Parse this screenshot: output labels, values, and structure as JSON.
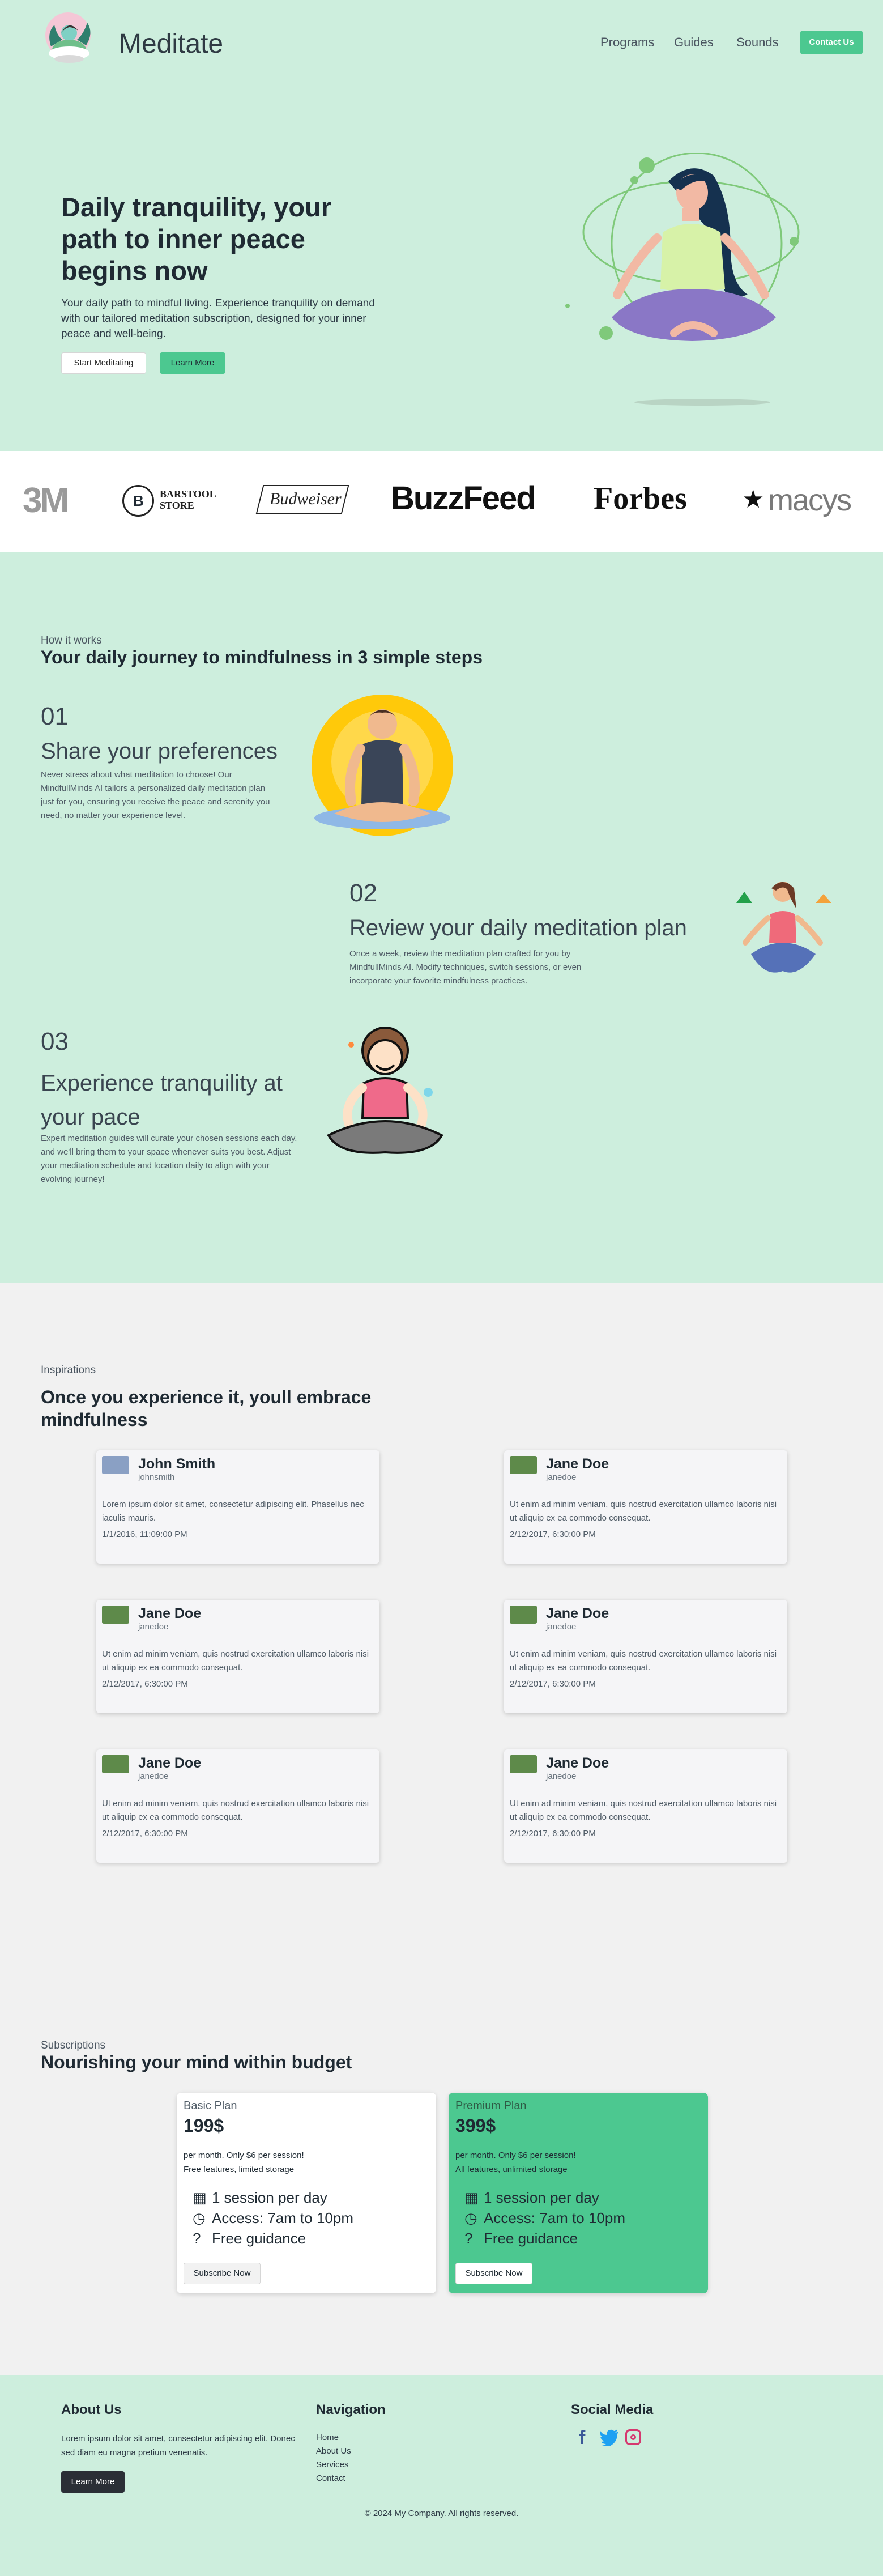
{
  "header": {
    "brand": "Meditate",
    "nav": [
      "Programs",
      "Guides",
      "Sounds"
    ],
    "contact_label": "Contact Us"
  },
  "hero": {
    "title": "Daily tranquility, your path to inner peace begins now",
    "subtitle": "Your daily path to mindful living. Experience tranquility on demand with our tailored meditation subscription, designed for your inner peace and well-being.",
    "primary_label": "Start Meditating",
    "secondary_label": "Learn More"
  },
  "logos": {
    "items": [
      "3M",
      "BARSTOOL STORE",
      "Budweiser",
      "BuzzFeed",
      "Forbes",
      "macys"
    ]
  },
  "how": {
    "eyebrow": "How it works",
    "title": "Your daily journey to mindfulness in 3 simple steps",
    "steps": [
      {
        "num": "01",
        "title": "Share your preferences",
        "text": "Never stress about what meditation to choose! Our MindfullMinds AI tailors a personalized daily meditation plan just for you, ensuring you receive the peace and serenity you need, no matter your experience level."
      },
      {
        "num": "02",
        "title": "Review your daily meditation plan",
        "text": "Once a week, review the meditation plan crafted for you by MindfullMinds AI. Modify techniques, switch sessions, or even incorporate your favorite mindfulness practices."
      },
      {
        "num": "03",
        "title": "Experience tranquility at your pace",
        "text": "Expert meditation guides will curate your chosen sessions each day, and we'll bring them to your space whenever suits you best. Adjust your meditation schedule and location daily to align with your evolving journey!"
      }
    ]
  },
  "inspirations": {
    "eyebrow": "Inspirations",
    "title": "Once you experience it, youll embrace mindfulness",
    "cards": [
      {
        "name": "John Smith",
        "handle": "johnsmith",
        "body": "Lorem ipsum dolor sit amet, consectetur adipiscing elit. Phasellus nec iaculis mauris.",
        "date": "1/1/2016, 11:09:00 PM"
      },
      {
        "name": "Jane Doe",
        "handle": "janedoe",
        "body": "Ut enim ad minim veniam, quis nostrud exercitation ullamco laboris nisi ut aliquip ex ea commodo consequat.",
        "date": "2/12/2017, 6:30:00 PM"
      },
      {
        "name": "Jane Doe",
        "handle": "janedoe",
        "body": "Ut enim ad minim veniam, quis nostrud exercitation ullamco laboris nisi ut aliquip ex ea commodo consequat.",
        "date": "2/12/2017, 6:30:00 PM"
      },
      {
        "name": "Jane Doe",
        "handle": "janedoe",
        "body": "Ut enim ad minim veniam, quis nostrud exercitation ullamco laboris nisi ut aliquip ex ea commodo consequat.",
        "date": "2/12/2017, 6:30:00 PM"
      },
      {
        "name": "Jane Doe",
        "handle": "janedoe",
        "body": "Ut enim ad minim veniam, quis nostrud exercitation ullamco laboris nisi ut aliquip ex ea commodo consequat.",
        "date": "2/12/2017, 6:30:00 PM"
      },
      {
        "name": "Jane Doe",
        "handle": "janedoe",
        "body": "Ut enim ad minim veniam, quis nostrud exercitation ullamco laboris nisi ut aliquip ex ea commodo consequat.",
        "date": "2/12/2017, 6:30:00 PM"
      }
    ]
  },
  "pricing": {
    "eyebrow": "Subscriptions",
    "title": "Nourishing your mind within budget",
    "plans": [
      {
        "name": "Basic Plan",
        "price": "199$",
        "desc1": "per month. Only $6 per session!",
        "desc2": "Free features, limited storage",
        "features": [
          "1 session per day",
          "Access: 7am to 10pm",
          "Free guidance"
        ],
        "cta": "Subscribe Now"
      },
      {
        "name": "Premium Plan",
        "price": "399$",
        "desc1": "per month. Only $6 per session!",
        "desc2": "All features, unlimited storage",
        "features": [
          "1 session per day",
          "Access: 7am to 10pm",
          "Free guidance"
        ],
        "cta": "Subscribe Now"
      }
    ]
  },
  "footer": {
    "about_title": "About Us",
    "about_text": "Lorem ipsum dolor sit amet, consectetur adipiscing elit. Donec sed diam eu magna pretium venenatis.",
    "about_btn": "Learn More",
    "nav_title": "Navigation",
    "nav_links": [
      "Home",
      "About Us",
      "Services",
      "Contact"
    ],
    "social_title": "Social Media",
    "social_icons": [
      "facebook-icon",
      "twitter-icon",
      "instagram-icon"
    ],
    "copyright": "© 2024 My Company. All rights reserved."
  },
  "colors": {
    "mint": "#cdeedd",
    "accent_green": "#4cc890",
    "page_gray": "#f1f1f1"
  }
}
